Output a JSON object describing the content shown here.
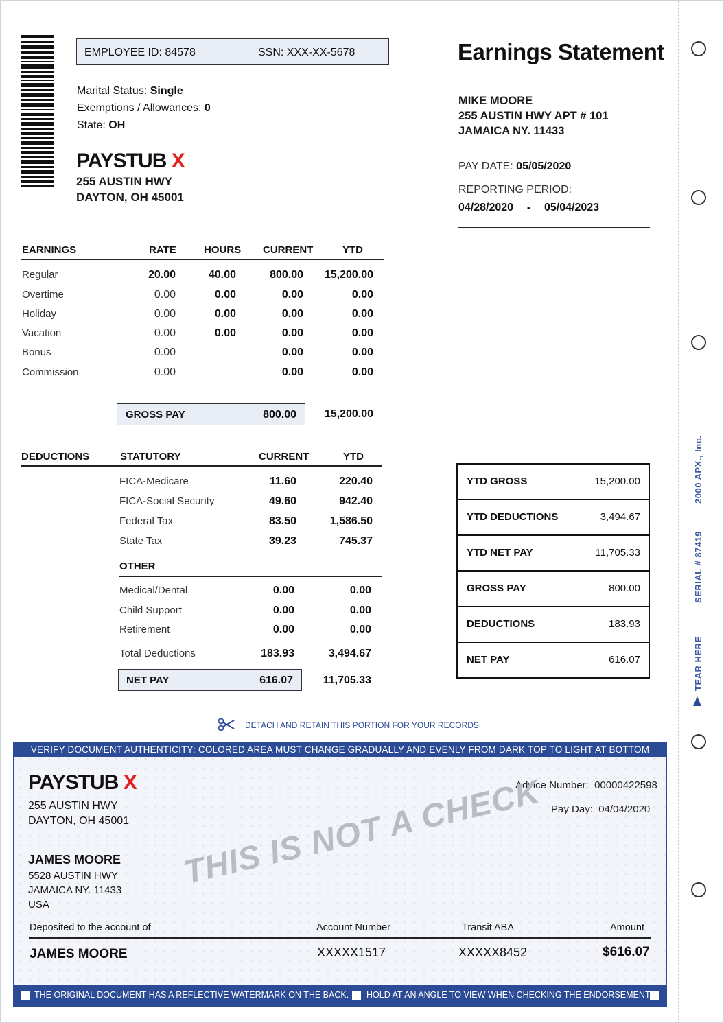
{
  "header": {
    "employee_id": "EMPLOYEE ID: 84578",
    "ssn": "SSN: XXX-XX-5678",
    "marital_label": "Marital Status: ",
    "marital_value": "Single",
    "exemptions_label": "Exemptions / Allowances: ",
    "exemptions_value": "0",
    "state_label": "State: ",
    "state_value": "OH",
    "title": "Earnings Statement"
  },
  "company": {
    "name": "PAYSTUB",
    "mark": "X",
    "address_line1": "255 AUSTIN HWY",
    "address_line2": "DAYTON, OH 45001"
  },
  "employee": {
    "name": "MIKE MOORE",
    "address_line1": "255 AUSTIN HWY APT # 101",
    "address_line2": "JAMAICA NY. 11433"
  },
  "pay_info": {
    "pay_date_label": "PAY DATE: ",
    "pay_date": "05/05/2020",
    "period_label": "REPORTING PERIOD:",
    "period_start": "04/28/2020",
    "period_sep": "-",
    "period_end": "05/04/2023"
  },
  "earnings": {
    "headers": [
      "EARNINGS",
      "RATE",
      "HOURS",
      "CURRENT",
      "YTD"
    ],
    "rows": [
      {
        "label": "Regular",
        "rate": "20.00",
        "hours": "40.00",
        "current": "800.00",
        "ytd": "15,200.00"
      },
      {
        "label": "Overtime",
        "rate": "0.00",
        "hours": "0.00",
        "current": "0.00",
        "ytd": "0.00"
      },
      {
        "label": "Holiday",
        "rate": "0.00",
        "hours": "0.00",
        "current": "0.00",
        "ytd": "0.00"
      },
      {
        "label": "Vacation",
        "rate": "0.00",
        "hours": "0.00",
        "current": "0.00",
        "ytd": "0.00"
      },
      {
        "label": "Bonus",
        "rate": "0.00",
        "hours": "",
        "current": "0.00",
        "ytd": "0.00"
      },
      {
        "label": "Commission",
        "rate": "0.00",
        "hours": "",
        "current": "0.00",
        "ytd": "0.00"
      }
    ],
    "gross_label": "GROSS PAY",
    "gross_current": "800.00",
    "gross_ytd": "15,200.00"
  },
  "deductions": {
    "headers": [
      "DEDUCTIONS",
      "STATUTORY",
      "CURRENT",
      "YTD"
    ],
    "statutory": [
      {
        "label": "FICA-Medicare",
        "current": "11.60",
        "ytd": "220.40"
      },
      {
        "label": "FICA-Social Security",
        "current": "49.60",
        "ytd": "942.40"
      },
      {
        "label": "Federal Tax",
        "current": "83.50",
        "ytd": "1,586.50"
      },
      {
        "label": "State Tax",
        "current": "39.23",
        "ytd": "745.37"
      }
    ],
    "other_label": "OTHER",
    "other": [
      {
        "label": "Medical/Dental",
        "current": "0.00",
        "ytd": "0.00"
      },
      {
        "label": "Child Support",
        "current": "0.00",
        "ytd": "0.00"
      },
      {
        "label": "Retirement",
        "current": "0.00",
        "ytd": "0.00"
      }
    ],
    "total_label": "Total Deductions",
    "total_current": "183.93",
    "total_ytd": "3,494.67",
    "net_label": "NET PAY",
    "net_current": "616.07",
    "net_ytd": "11,705.33"
  },
  "summary": [
    {
      "label": "YTD GROSS",
      "value": "15,200.00"
    },
    {
      "label": "YTD DEDUCTIONS",
      "value": "3,494.67"
    },
    {
      "label": "YTD NET PAY",
      "value": "11,705.33"
    },
    {
      "label": "GROSS PAY",
      "value": "800.00"
    },
    {
      "label": "DEDUCTIONS",
      "value": "183.93"
    },
    {
      "label": "NET PAY",
      "value": "616.07"
    }
  ],
  "side": {
    "tear": "TEAR HERE",
    "serial": "SERIAL # 87419",
    "vendor": "2000 APX., Inc."
  },
  "detach_text": "DETACH AND RETAIN THIS PORTION FOR YOUR RECORDS",
  "check": {
    "banner": "VERIFY DOCUMENT AUTHENTICITY: COLORED AREA MUST CHANGE GRADUALLY AND EVENLY FROM DARK TOP TO LIGHT AT BOTTOM",
    "advice_label": "Advice Number:",
    "advice_number": "00000422598",
    "payday_label": "Pay Day:",
    "payday": "04/04/2020",
    "payee_name": "JAMES MOORE",
    "payee_line1": "5528 AUSTIN HWY",
    "payee_line2": "JAMAICA NY. 11433",
    "payee_line3": "USA",
    "watermark": "THIS IS NOT A CHECK",
    "deposit_label": "Deposited to the account of",
    "account_label": "Account Number",
    "transit_label": "Transit ABA",
    "amount_label": "Amount",
    "deposit_name": "JAMES MOORE",
    "account_number": "XXXXX1517",
    "transit_number": "XXXXX8452",
    "amount": "$616.07",
    "footer_left": "THE ORIGINAL DOCUMENT HAS A REFLECTIVE WATERMARK ON THE BACK.",
    "footer_right": "HOLD AT AN ANGLE TO VIEW WHEN CHECKING THE ENDORSEMENT."
  },
  "colors": {
    "accent_blue": "#2c4b96",
    "brand_red": "#e1201f",
    "box_fill": "#e9edf5"
  },
  "icons": [
    "barcode-icon",
    "scissors-icon",
    "hole-punch-icon",
    "arrow-up-icon"
  ]
}
